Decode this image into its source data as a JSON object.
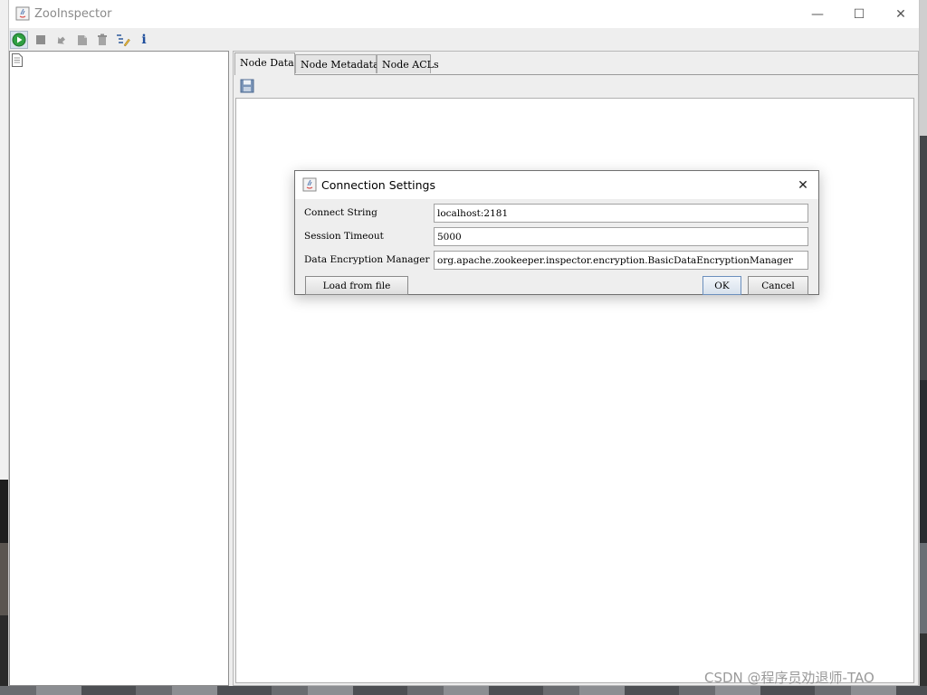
{
  "window": {
    "title": "ZooInspector",
    "controls": {
      "minimize": "—",
      "maximize": "☐",
      "close": "✕"
    }
  },
  "toolbar": {
    "buttons": [
      {
        "name": "connect",
        "icon": "play-circle-icon"
      },
      {
        "name": "disconnect",
        "icon": "stop-icon"
      },
      {
        "name": "refresh",
        "icon": "refresh-icon"
      },
      {
        "name": "add-node",
        "icon": "add-node-icon"
      },
      {
        "name": "delete-node",
        "icon": "trash-icon"
      },
      {
        "name": "node-viewers",
        "icon": "edit-tree-icon"
      },
      {
        "name": "about",
        "icon": "info-icon",
        "glyph": "i"
      }
    ]
  },
  "tree": {
    "root_icon": "document-icon"
  },
  "tabs": [
    {
      "label": "Node Data",
      "active": true
    },
    {
      "label": "Node Metadata",
      "active": false
    },
    {
      "label": "Node ACLs",
      "active": false
    }
  ],
  "editor": {
    "save_icon": "save-icon"
  },
  "dialog": {
    "title": "Connection Settings",
    "close": "✕",
    "fields": [
      {
        "label": "Connect String",
        "value": "localhost:2181"
      },
      {
        "label": "Session Timeout",
        "value": "5000"
      },
      {
        "label": "Data Encryption Manager",
        "value": "org.apache.zookeeper.inspector.encryption.BasicDataEncryptionManager"
      }
    ],
    "buttons": {
      "load": "Load from file",
      "ok": "OK",
      "cancel": "Cancel"
    }
  },
  "watermark": "CSDN @程序员劝退师-TAO",
  "colors": {
    "connect_green": "#2ea043",
    "info_blue": "#1f4e9c",
    "ok_border": "#6b8fbd"
  }
}
